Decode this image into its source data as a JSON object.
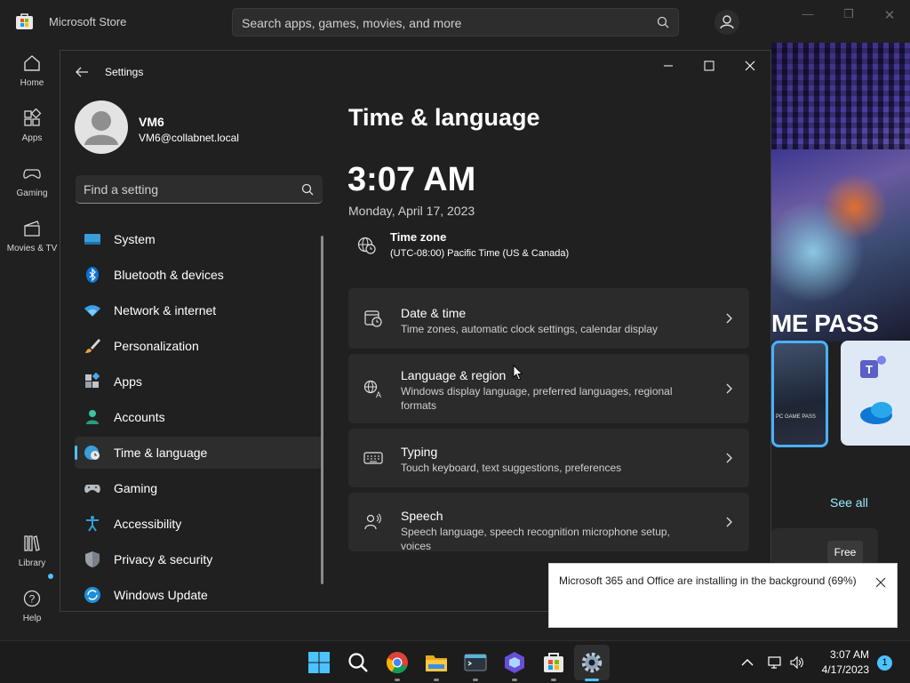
{
  "store": {
    "title": "Microsoft Store",
    "search_placeholder": "Search apps, games, movies, and more",
    "nav": [
      {
        "label": "Home"
      },
      {
        "label": "Apps"
      },
      {
        "label": "Gaming"
      },
      {
        "label": "Movies & TV"
      },
      {
        "label": "Library"
      },
      {
        "label": "Help"
      }
    ],
    "hero_title": "ME PASS",
    "tile_caption": "PC GAME PASS",
    "see_all": "See all",
    "free_label": "Free"
  },
  "settings": {
    "title": "Settings",
    "user": {
      "name": "VM6",
      "email": "VM6@collabnet.local"
    },
    "search_placeholder": "Find a setting",
    "sidebar": [
      {
        "label": "System",
        "icon": "system-icon"
      },
      {
        "label": "Bluetooth & devices",
        "icon": "bluetooth-icon"
      },
      {
        "label": "Network & internet",
        "icon": "wifi-icon"
      },
      {
        "label": "Personalization",
        "icon": "brush-icon"
      },
      {
        "label": "Apps",
        "icon": "apps-icon"
      },
      {
        "label": "Accounts",
        "icon": "accounts-icon"
      },
      {
        "label": "Time & language",
        "icon": "globe-clock-icon",
        "active": true
      },
      {
        "label": "Gaming",
        "icon": "gamepad-icon"
      },
      {
        "label": "Accessibility",
        "icon": "accessibility-icon"
      },
      {
        "label": "Privacy & security",
        "icon": "shield-icon"
      },
      {
        "label": "Windows Update",
        "icon": "update-icon"
      }
    ],
    "page_title": "Time & language",
    "clock": "3:07 AM",
    "date": "Monday, April 17, 2023",
    "timezone": {
      "label": "Time zone",
      "value": "(UTC-08:00) Pacific Time (US & Canada)"
    },
    "cards": [
      {
        "title": "Date & time",
        "desc": "Time zones, automatic clock settings, calendar display",
        "icon": "calendar-clock-icon"
      },
      {
        "title": "Language & region",
        "desc": "Windows display language, preferred languages, regional formats",
        "icon": "language-icon"
      },
      {
        "title": "Typing",
        "desc": "Touch keyboard, text suggestions, preferences",
        "icon": "keyboard-icon"
      },
      {
        "title": "Speech",
        "desc": "Speech language, speech recognition microphone setup, voices",
        "icon": "speech-icon"
      }
    ]
  },
  "toast": {
    "text": "Microsoft 365 and Office are installing in the background (69%)"
  },
  "taskbar": {
    "apps": [
      "start-icon",
      "search-icon",
      "chrome-icon",
      "file-explorer-icon",
      "terminal-icon",
      "copilot-icon",
      "store-icon",
      "settings-icon"
    ],
    "time": "3:07 AM",
    "date": "4/17/2023",
    "notification_count": "1"
  },
  "colors": {
    "accent": "#4cc2ff",
    "background": "#202020",
    "card": "#2b2b2b"
  }
}
